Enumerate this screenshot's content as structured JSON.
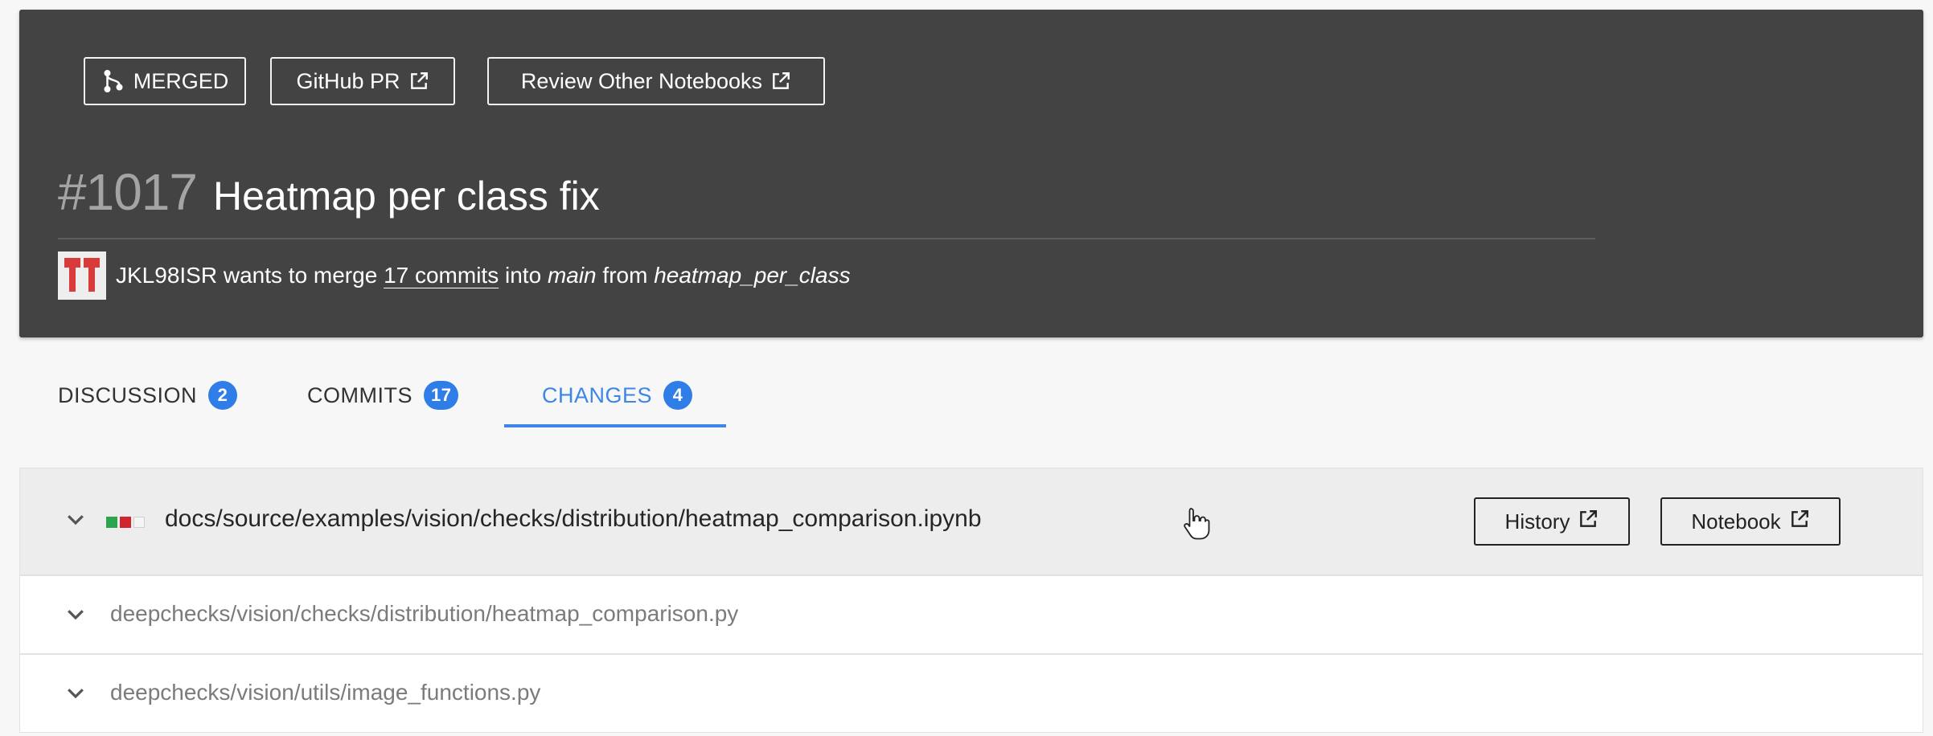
{
  "header": {
    "status_label": "MERGED",
    "github_pr_label": "GitHub PR",
    "review_other_label": "Review Other Notebooks",
    "pr_number": "#1017",
    "pr_title": "Heatmap per class fix",
    "meta": {
      "user": "JKL98ISR",
      "wants_to_merge": "wants to merge",
      "commits_link": "17 commits",
      "into": "into",
      "target_branch": "main",
      "from": "from",
      "source_branch": "heatmap_per_class"
    }
  },
  "tabs": [
    {
      "label": "DISCUSSION",
      "count": "2"
    },
    {
      "label": "COMMITS",
      "count": "17"
    },
    {
      "label": "CHANGES",
      "count": "4"
    }
  ],
  "files": [
    {
      "path": "docs/source/examples/vision/checks/distribution/heatmap_comparison.ipynb",
      "history_label": "History",
      "notebook_label": "Notebook"
    },
    {
      "path": "deepchecks/vision/checks/distribution/heatmap_comparison.py"
    },
    {
      "path": "deepchecks/vision/utils/image_functions.py"
    }
  ],
  "colors": {
    "header_bg": "#434343",
    "accent": "#3d86e8",
    "added": "#2da44e",
    "removed": "#d1242f"
  },
  "icons": [
    "merge-icon",
    "external-link-icon",
    "chevron-down-icon",
    "avatar",
    "pointer-cursor-icon"
  ]
}
